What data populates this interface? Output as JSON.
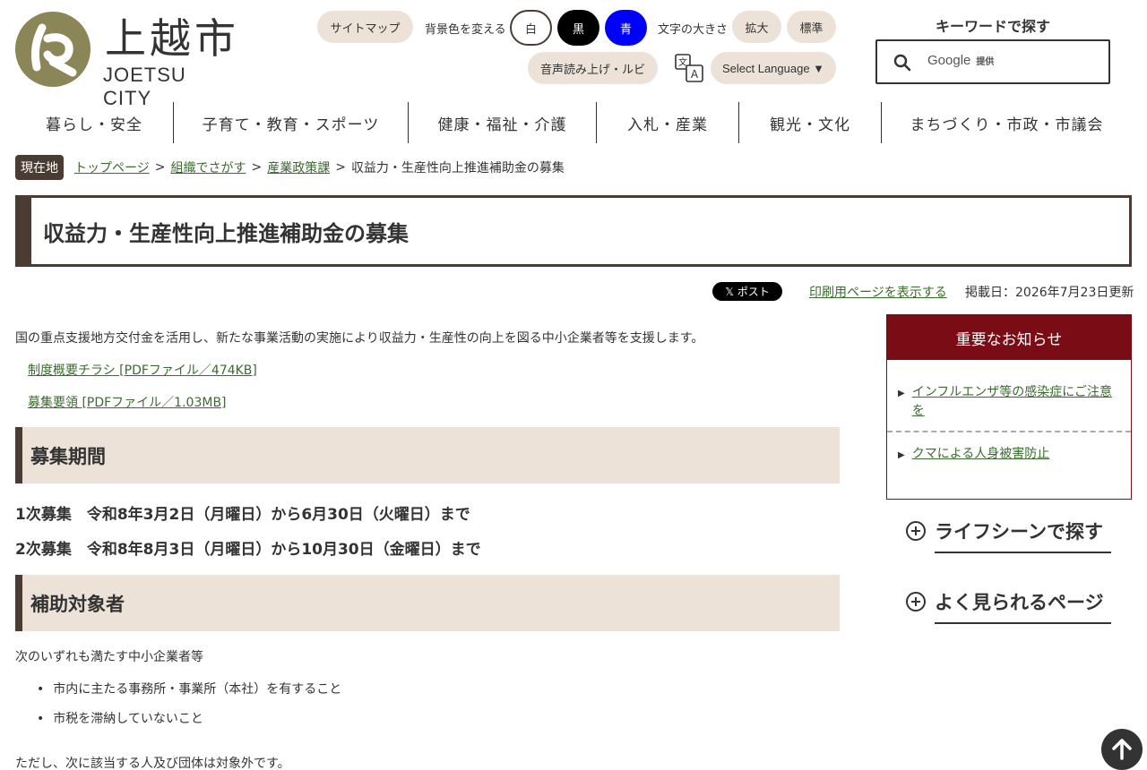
{
  "header": {
    "logo_kanji": "上越市",
    "logo_en": "JOETSU CITY",
    "sitemap": "サイトマップ",
    "bg_color_label": "背景色を変える",
    "bg_white": "白",
    "bg_black": "黒",
    "bg_blue": "青",
    "font_size_label": "文字の大きさ",
    "font_enlarge": "拡大",
    "font_standard": "標準",
    "read_aloud": "音声読み上げ・ルビ",
    "select_language": "Select Language ▼",
    "search_title": "キーワードで探す",
    "search_google": "Google",
    "search_google_sub": "提供"
  },
  "nav": [
    {
      "label": "暮らし・安全"
    },
    {
      "label": "子育て・教育・スポーツ"
    },
    {
      "label": "健康・福祉・介護"
    },
    {
      "label": "入札・産業"
    },
    {
      "label": "観光・文化"
    },
    {
      "label": "まちづくり・市政・市議会"
    }
  ],
  "breadcrumb": {
    "here": "現在地",
    "items": [
      "トップページ",
      "組織でさがす",
      "産業政策課"
    ],
    "current": "収益力・生産性向上推進補助金の募集"
  },
  "page": {
    "title": "収益力・生産性向上推進補助金の募集",
    "post": "𝕏 ポスト",
    "print": "印刷用ページを表示する",
    "pubdate": "掲載日：2026年7月23日更新"
  },
  "main": {
    "intro": "国の重点支援地方交付金を活用し、新たな事業活動の実施により収益力・生産性の向上を図る中小企業者等を支援します。",
    "links": [
      "制度概要チラシ [PDFファイル／474KB]",
      "募集要領 [PDFファイル／1.03MB]"
    ],
    "section1_title": "募集期間",
    "period1": "1次募集　令和8年3月2日（月曜日）から6月30日（火曜日）まで",
    "period2": "2次募集　令和8年8月3日（月曜日）から10月30日（金曜日）まで",
    "section2_title": "補助対象者",
    "target_intro": "次のいずれも満たす中小企業者等",
    "bullets": [
      "市内に主たる事務所・事業所（本社）を有すること",
      "市税を滞納していないこと"
    ],
    "exclusion": "ただし、次に該当する人及び団体は対象外です。"
  },
  "sidebar": {
    "notice_title": "重要なお知らせ",
    "notices": [
      "インフルエンザ等の感染症にご注意を",
      "クマによる人身被害防止"
    ],
    "accordions": [
      "ライフシーンで探す",
      "よく見られるページ"
    ]
  },
  "colors": {
    "accent_dark": "#4a3c33",
    "beige": "#ece2d8",
    "notice_red": "#7a0c15",
    "logo_olive": "#8a8658",
    "link_green": "#3b6b2e"
  }
}
